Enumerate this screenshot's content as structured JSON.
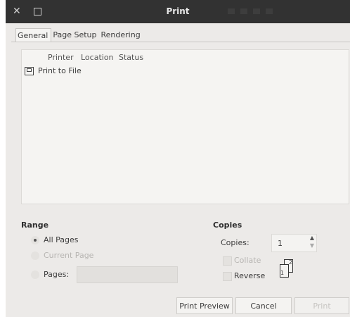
{
  "window": {
    "title": "Print"
  },
  "tabs": [
    {
      "label": "General",
      "active": true
    },
    {
      "label": "Page Setup",
      "active": false
    },
    {
      "label": "Rendering",
      "active": false
    }
  ],
  "printer_list": {
    "columns": [
      "Printer",
      "Location",
      "Status"
    ],
    "rows": [
      {
        "icon": "printer-icon",
        "name": "Print to File"
      }
    ]
  },
  "range": {
    "title": "Range",
    "options": [
      {
        "label": "All Pages",
        "selected": true,
        "enabled": true
      },
      {
        "label": "Current Page",
        "selected": false,
        "enabled": false
      },
      {
        "label": "Pages:",
        "selected": false,
        "enabled": true
      }
    ],
    "pages_value": ""
  },
  "copies": {
    "title": "Copies",
    "label": "Copies:",
    "value": "1",
    "collate": {
      "label": "Collate",
      "checked": false,
      "enabled": false
    },
    "reverse": {
      "label": "Reverse",
      "checked": false,
      "enabled": true
    },
    "preview_pages": [
      "2",
      "1"
    ]
  },
  "buttons": {
    "print_preview": "Print Preview",
    "cancel": "Cancel",
    "print": "Print"
  }
}
